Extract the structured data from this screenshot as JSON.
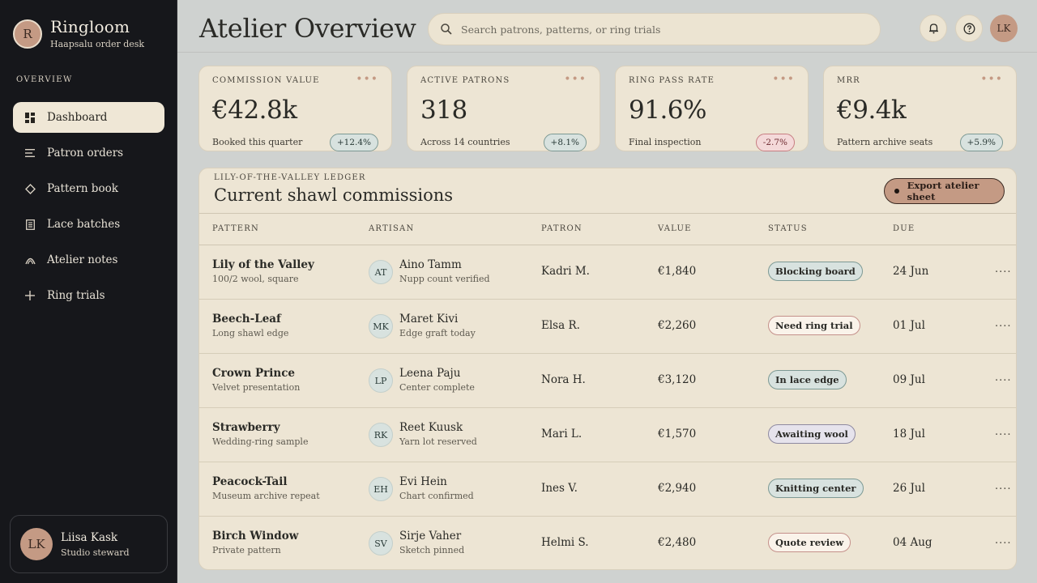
{
  "app": {
    "logo_letter": "R",
    "name": "Ringloom",
    "subtitle": "Haapsalu order desk"
  },
  "sidebar": {
    "section_label": "OVERVIEW",
    "items": [
      {
        "label": "Dashboard",
        "icon": "dashboard-icon",
        "active": true
      },
      {
        "label": "Patron orders",
        "icon": "list-icon",
        "active": false
      },
      {
        "label": "Pattern book",
        "icon": "diamond-icon",
        "active": false
      },
      {
        "label": "Lace batches",
        "icon": "document-icon",
        "active": false
      },
      {
        "label": "Atelier notes",
        "icon": "notes-icon",
        "active": false
      },
      {
        "label": "Ring trials",
        "icon": "plus-icon",
        "active": false
      }
    ],
    "user": {
      "initials": "LK",
      "name": "Liisa Kask",
      "role": "Studio steward"
    }
  },
  "header": {
    "title": "Atelier Overview",
    "search_placeholder": "Search patrons, patterns, or ring trials",
    "avatar_initials": "LK"
  },
  "kpis": [
    {
      "label": "COMMISSION VALUE",
      "value": "€42.8k",
      "caption": "Booked this quarter",
      "delta": "+12.4%",
      "trend": "up"
    },
    {
      "label": "ACTIVE PATRONS",
      "value": "318",
      "caption": "Across 14 countries",
      "delta": "+8.1%",
      "trend": "up"
    },
    {
      "label": "RING PASS RATE",
      "value": "91.6%",
      "caption": "Final inspection",
      "delta": "-2.7%",
      "trend": "down"
    },
    {
      "label": "MRR",
      "value": "€9.4k",
      "caption": "Pattern archive seats",
      "delta": "+5.9%",
      "trend": "up"
    }
  ],
  "ledger": {
    "kicker": "LILY-OF-THE-VALLEY LEDGER",
    "title": "Current shawl commissions",
    "export_label": "Export atelier sheet",
    "columns": [
      "PATTERN",
      "ARTISAN",
      "PATRON",
      "VALUE",
      "STATUS",
      "DUE"
    ],
    "rows": [
      {
        "pattern": "Lily of the Valley",
        "pattern_sub": "100/2 wool, square",
        "initials": "AT",
        "artisan": "Aino Tamm",
        "artisan_sub": "Nupp count verified",
        "patron": "Kadri M.",
        "value": "€1,840",
        "status": "Blocking board",
        "status_tone": "teal",
        "due": "24 Jun"
      },
      {
        "pattern": "Beech-Leaf",
        "pattern_sub": "Long shawl edge",
        "initials": "MK",
        "artisan": "Maret Kivi",
        "artisan_sub": "Edge graft today",
        "patron": "Elsa R.",
        "value": "€2,260",
        "status": "Need ring trial",
        "status_tone": "rose",
        "due": "01 Jul"
      },
      {
        "pattern": "Crown Prince",
        "pattern_sub": "Velvet presentation",
        "initials": "LP",
        "artisan": "Leena Paju",
        "artisan_sub": "Center complete",
        "patron": "Nora H.",
        "value": "€3,120",
        "status": "In lace edge",
        "status_tone": "teal",
        "due": "09 Jul"
      },
      {
        "pattern": "Strawberry",
        "pattern_sub": "Wedding-ring sample",
        "initials": "RK",
        "artisan": "Reet Kuusk",
        "artisan_sub": "Yarn lot reserved",
        "patron": "Mari L.",
        "value": "€1,570",
        "status": "Awaiting wool",
        "status_tone": "lav",
        "due": "18 Jul"
      },
      {
        "pattern": "Peacock-Tail",
        "pattern_sub": "Museum archive repeat",
        "initials": "EH",
        "artisan": "Evi Hein",
        "artisan_sub": "Chart confirmed",
        "patron": "Ines V.",
        "value": "€2,940",
        "status": "Knitting center",
        "status_tone": "teal",
        "due": "26 Jul"
      },
      {
        "pattern": "Birch Window",
        "pattern_sub": "Private pattern",
        "initials": "SV",
        "artisan": "Sirje Vaher",
        "artisan_sub": "Sketch pinned",
        "patron": "Helmi S.",
        "value": "€2,480",
        "status": "Quote review",
        "status_tone": "rose",
        "due": "04 Aug"
      }
    ]
  },
  "colors": {
    "sidebar_bg": "#16171b",
    "card_bg": "#ede5d4",
    "accent_rose": "#c49a84",
    "badge_up": "#d8e2df",
    "badge_down": "#f4d9d9"
  }
}
